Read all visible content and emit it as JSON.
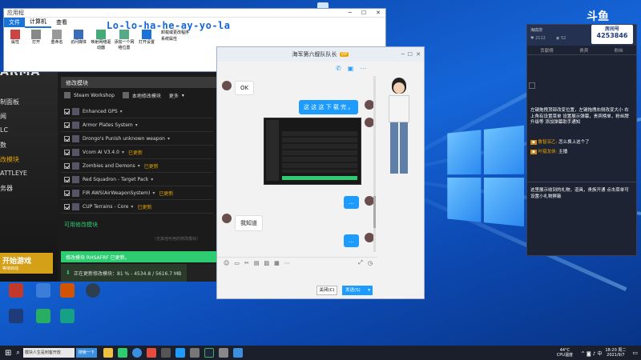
{
  "overlay_title": "Lo-lo-ha-he-ay-yo-la",
  "explorer": {
    "title": "应用程",
    "tabs": [
      "文件",
      "计算机",
      "查看"
    ],
    "ribbon": [
      "属性",
      "打开",
      "重命名",
      "访问媒体",
      "映射网络驱动器",
      "添加一个网络位置",
      "打开设置",
      "卸载或更改程序",
      "系统属性"
    ]
  },
  "arma": {
    "logo": "ARMA",
    "sidebar": [
      "制面板",
      "闻",
      "LC",
      "数",
      "改模块",
      "ATTLEYE",
      "务器"
    ],
    "play_label": "开始游戏",
    "play_sub": "等待启动",
    "section_title": "修改模块",
    "toolbar": {
      "workshop": "Steam Workshop",
      "local": "本地修改模块",
      "more": "更多"
    },
    "mods": [
      {
        "name": "Enhanced GPS",
        "tag": ""
      },
      {
        "name": "Armor Plates System",
        "tag": ""
      },
      {
        "name": "Drongo's Punish unknown weapon",
        "tag": ""
      },
      {
        "name": "Vcom AI V3.4.0",
        "tag": "已更新"
      },
      {
        "name": "Zombies and Demons",
        "tag": "已更新"
      },
      {
        "name": "Red Squadron - Target Pack",
        "tag": ""
      },
      {
        "name": "FIR AWS(AirWeaponSystem)",
        "tag": "已更新"
      },
      {
        "name": "CUP Terrains - Core",
        "tag": "已更新"
      }
    ],
    "available": "可用修改模块",
    "none_found": "（无其他可用的修改模块）",
    "updated_notice": "修改模块 RHSAFRF 已更新。",
    "progress": {
      "label": "正在更新修改模块：81 % - 4534.8 / 5616.7 MB",
      "fraction": 0.81
    }
  },
  "chat": {
    "title": "海军第六舰队队长",
    "vip": "VIP",
    "messages": [
      {
        "side": "left",
        "text": "OK"
      },
      {
        "side": "right",
        "text": "这 这 这 下 载 完 。"
      },
      {
        "side": "right",
        "text": "..."
      },
      {
        "side": "left",
        "text": "我知道"
      },
      {
        "side": "right",
        "text": "..."
      }
    ],
    "close_label": "关闭(C)",
    "send_label": "发送(S)"
  },
  "live": {
    "brand": "斗鱼",
    "room_label": "房间号",
    "room_number": "4253846",
    "streamer": "海底捞",
    "stat1": "2112",
    "stat2": "52",
    "tabs": [
      "贡献榜",
      "贵宾",
      "粉丝"
    ],
    "notice": "左键拖拽顶部改变位置，左键拖拽右侧改变大小 右上角有设置菜单 设置展示弹幕，贵宾榜单，粉丝牌升级等 添加弹幕助手通知",
    "chat": [
      {
        "name": "鲁智深乙:",
        "text": "怎么换上这个了"
      },
      {
        "name": "叶猎龙侠:",
        "text": "主播"
      }
    ],
    "gift_notice": "这里展示收到的礼物，道具，贵族开通 点击菜单可设置小礼物屏蔽"
  },
  "taskbar": {
    "search": "搜索一下",
    "app_label": "模块人生是刺客开放",
    "weather_temp": "44°C",
    "weather_sub": "CPU温度",
    "time": "18:20 周二",
    "date": "2021/9/7"
  },
  "colors": {
    "accent_green": "#2ecc71",
    "play_gold": "#d4a017",
    "douyu_blue": "#1f3b7a",
    "bubble_blue": "#1e9bff"
  }
}
